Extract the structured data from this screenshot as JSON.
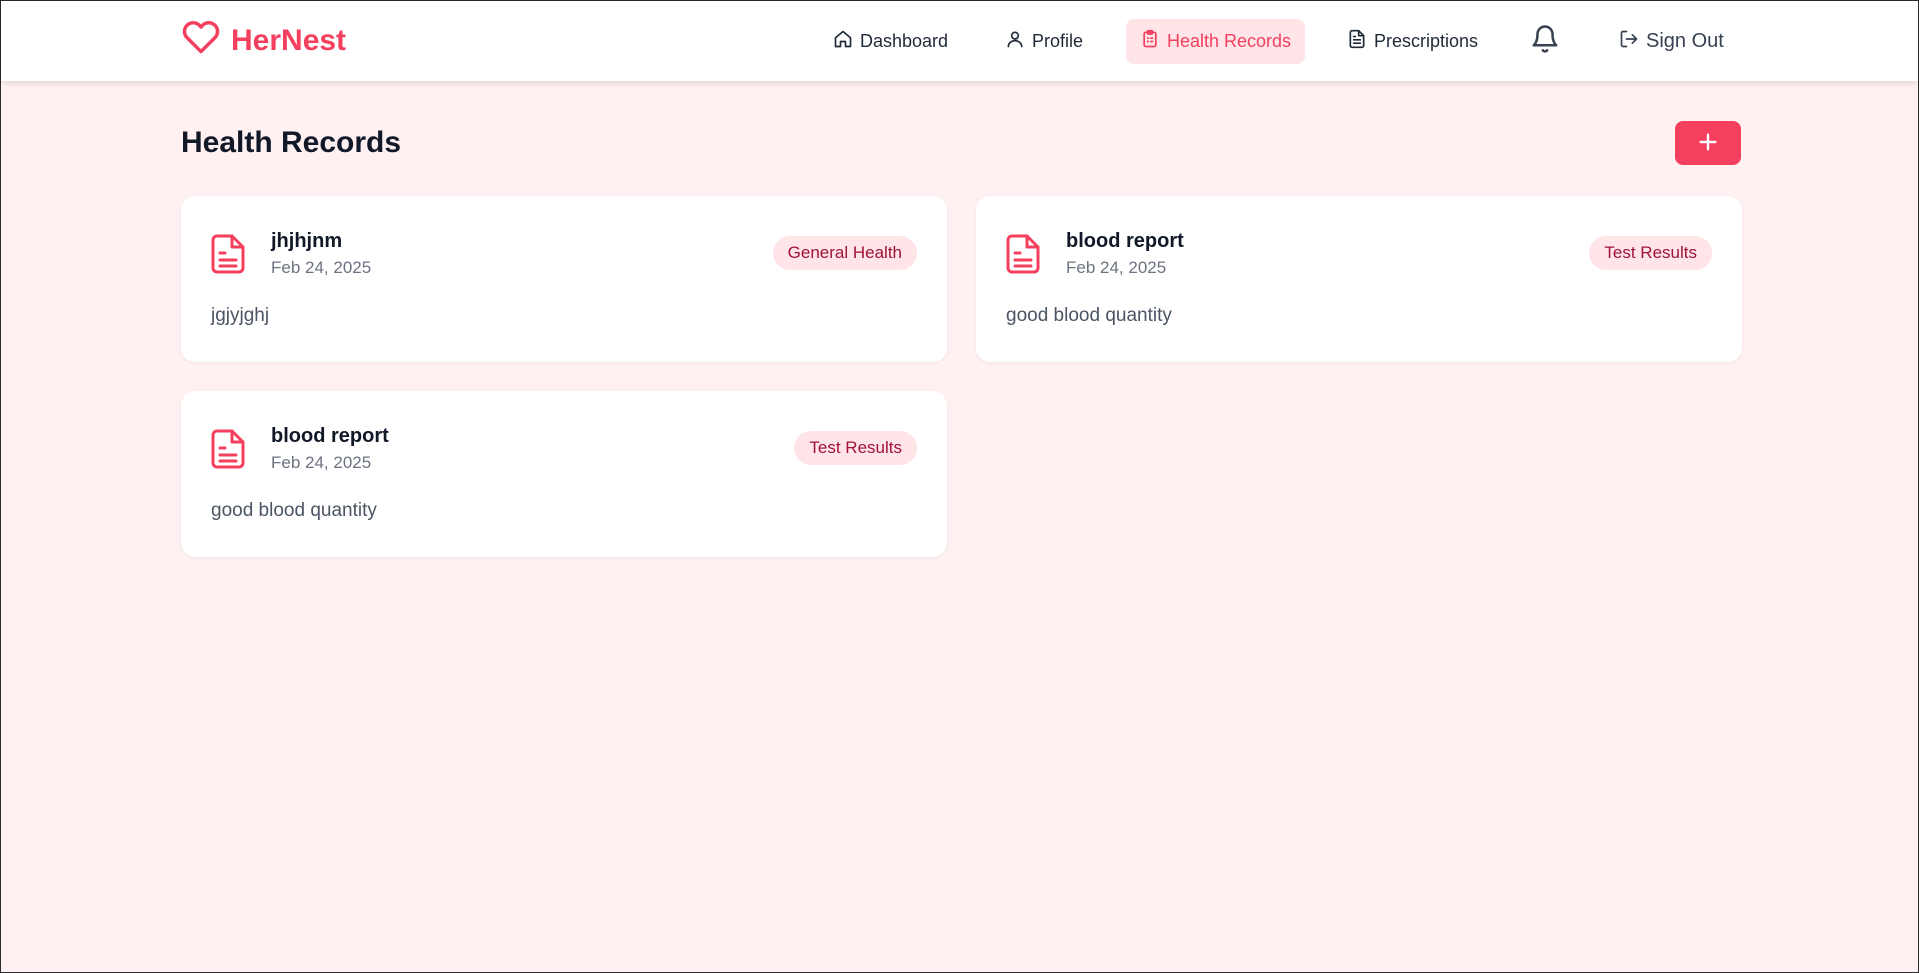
{
  "brand": {
    "name": "HerNest",
    "icon": "heart-icon",
    "accent": "#f43f5e"
  },
  "nav": {
    "items": [
      {
        "label": "Dashboard",
        "icon": "home-icon"
      },
      {
        "label": "Profile",
        "icon": "user-icon"
      },
      {
        "label": "Health Records",
        "icon": "clipboard-icon",
        "active": true
      },
      {
        "label": "Prescriptions",
        "icon": "file-text-icon"
      }
    ],
    "notifications_icon": "bell-icon",
    "sign_out": {
      "label": "Sign Out",
      "icon": "log-out-icon"
    }
  },
  "main": {
    "title": "Health Records",
    "add_icon": "plus-icon",
    "records": [
      {
        "title": "jhjhjnm",
        "date": "Feb 24, 2025",
        "category": "General Health",
        "description": "jgjyjghj"
      },
      {
        "title": "blood report",
        "date": "Feb 24, 2025",
        "category": "Test Results",
        "description": "good blood quantity"
      },
      {
        "title": "blood report",
        "date": "Feb 24, 2025",
        "category": "Test Results",
        "description": "good blood quantity"
      }
    ]
  },
  "colors": {
    "background": "#fff0f2",
    "accent": "#f43f5e",
    "badge_bg": "#ffe4e8",
    "badge_text": "#9f1239"
  }
}
